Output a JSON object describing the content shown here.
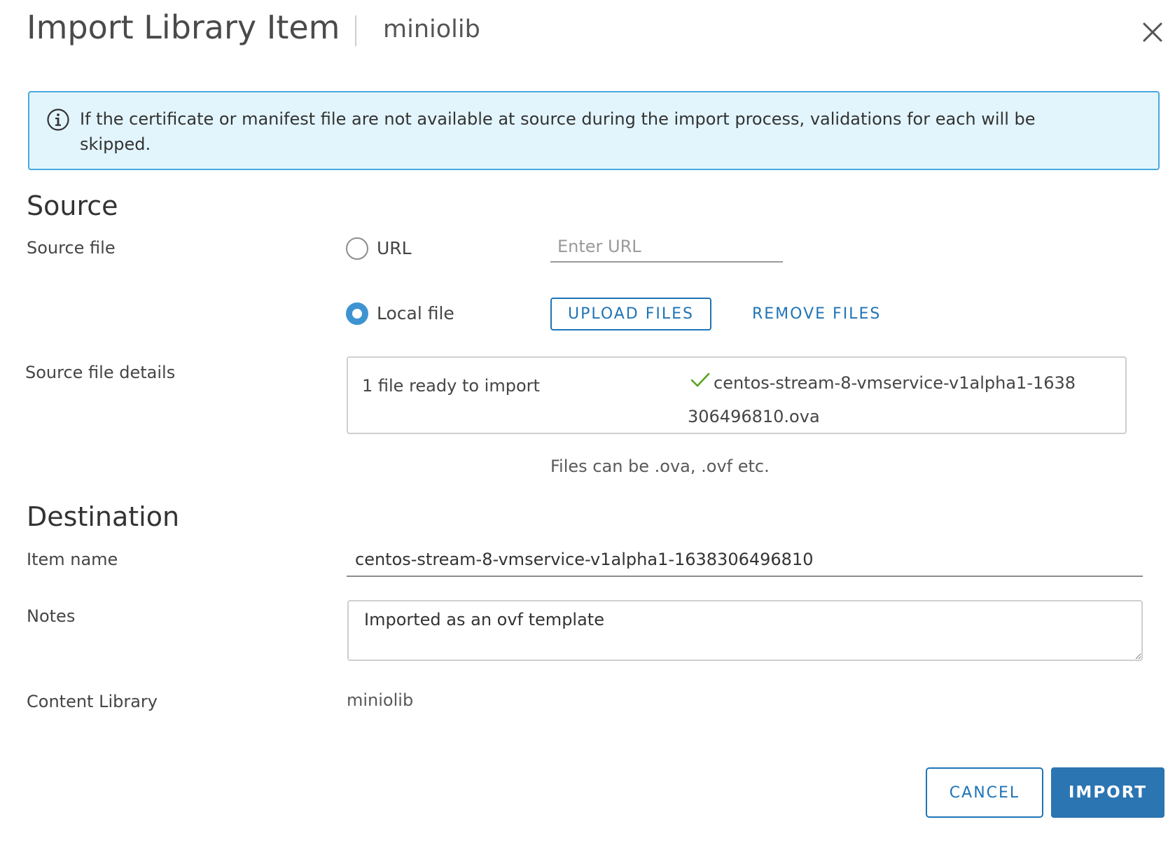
{
  "header": {
    "title": "Import Library Item",
    "subtitle": "miniolib",
    "close_icon": "close-icon"
  },
  "banner": {
    "icon": "info-icon",
    "text": "If the certificate or manifest file are not available at source during the import process, validations for each will be skipped.",
    "border_color": "#49a8de",
    "background_color": "#e2f5fd"
  },
  "source": {
    "title": "Source",
    "source_file_label": "Source file",
    "url_option_label": "URL",
    "url_placeholder": "Enter URL",
    "url_value": "",
    "local_file_label": "Local file",
    "selected_option": "Local file",
    "upload_button": "UPLOAD FILES",
    "remove_button": "REMOVE FILES",
    "details_label": "Source file details",
    "file_count_text": "1 file ready to import",
    "file_name": "centos-stream-8-vmservice-v1alpha1-1638306496810.ova",
    "file_status_icon": "check-icon",
    "helper_text": "Files can be .ova, .ovf etc."
  },
  "destination": {
    "title": "Destination",
    "item_name_label": "Item name",
    "item_name_value": "centos-stream-8-vmservice-v1alpha1-1638306496810",
    "notes_label": "Notes",
    "notes_value": "Imported as an ovf template",
    "content_library_label": "Content Library",
    "content_library_value": "miniolib"
  },
  "footer": {
    "cancel_button": "CANCEL",
    "import_button": "IMPORT"
  },
  "colors": {
    "accent": "#1f74b6",
    "primary_button": "#2b75b2",
    "radio_selected": "#3d94d1",
    "success_check": "#5aa220"
  }
}
